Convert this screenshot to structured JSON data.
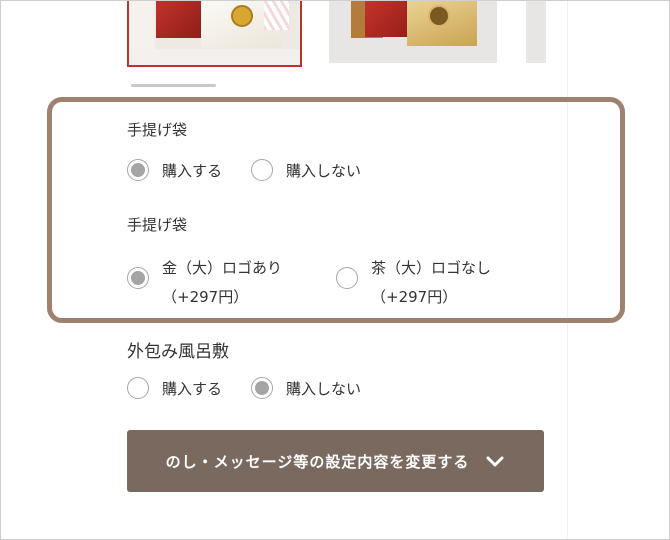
{
  "bag_section_1": {
    "title": "手提げ袋",
    "options": [
      {
        "label": "購入する",
        "selected": true
      },
      {
        "label": "購入しない",
        "selected": false
      }
    ]
  },
  "bag_section_2": {
    "title": "手提げ袋",
    "options": [
      {
        "label": "金（大）ロゴあり",
        "price": "（+297円）",
        "selected": true
      },
      {
        "label": "茶（大）ロゴなし",
        "price": "（+297円）",
        "selected": false
      }
    ]
  },
  "wrap_section": {
    "title": "外包み風呂敷",
    "options": [
      {
        "label": "購入する",
        "selected": false
      },
      {
        "label": "購入しない",
        "selected": true
      }
    ]
  },
  "settings_button": {
    "label": "のし・メッセージ等の設定内容を変更する",
    "icon": "chevron-down-icon"
  },
  "colors": {
    "highlight_border": "#9e8170",
    "button_bg": "#7a695e",
    "selected_thumb_border": "#b8342e",
    "radio_fill": "#a5a5a5"
  }
}
